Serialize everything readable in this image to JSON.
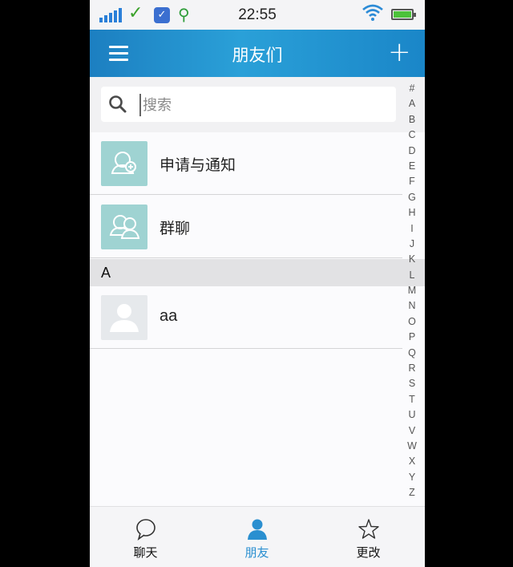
{
  "status_bar": {
    "time": "22:55"
  },
  "header": {
    "title": "朋友们"
  },
  "search": {
    "placeholder": "搜索"
  },
  "list": {
    "top_items": [
      {
        "label": "申请与通知"
      },
      {
        "label": "群聊"
      }
    ],
    "sections": [
      {
        "letter": "A",
        "contacts": [
          {
            "name": "aa"
          }
        ]
      }
    ]
  },
  "index_bar": [
    "#",
    "A",
    "B",
    "C",
    "D",
    "E",
    "F",
    "G",
    "H",
    "I",
    "J",
    "K",
    "L",
    "M",
    "N",
    "O",
    "P",
    "Q",
    "R",
    "S",
    "T",
    "U",
    "V",
    "W",
    "X",
    "Y",
    "Z"
  ],
  "tab_bar": {
    "tabs": [
      {
        "label": "聊天",
        "icon": "chat-bubble-icon"
      },
      {
        "label": "朋友",
        "icon": "person-icon",
        "active": true
      },
      {
        "label": "更改",
        "icon": "star-icon"
      }
    ]
  },
  "colors": {
    "header_start": "#1c7fc1",
    "header_mid": "#2aa0d8",
    "accent": "#2a8fd0",
    "avatar_teal": "#9fd3d2"
  }
}
